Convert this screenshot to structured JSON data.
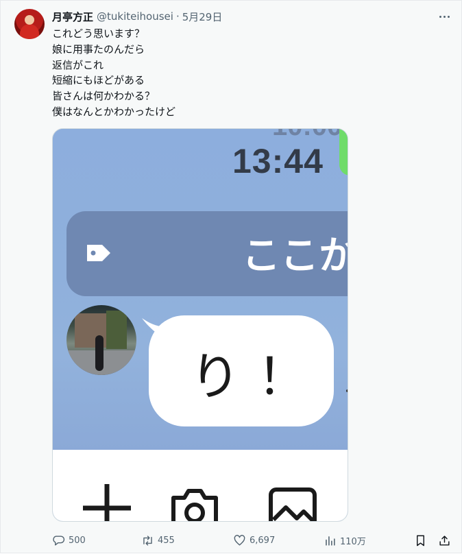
{
  "tweet": {
    "author_name": "月亭方正",
    "handle": "@tukiteihousei",
    "separator": "·",
    "date": "5月29日",
    "lines": [
      "これどう思います？",
      "娘に用事たのんだら",
      "返信がこれ",
      "短縮にもほどがある",
      "皆さんは何かわかる？",
      "僕はなんとかわかったけど"
    ]
  },
  "media": {
    "status_time_partial": "10:00",
    "time": "13:44",
    "banner_text": "ここか",
    "bubble_text": "り！",
    "icons": [
      "tag-icon",
      "plus-icon",
      "camera-icon",
      "image-icon"
    ]
  },
  "actions": {
    "replies": "500",
    "reposts": "455",
    "likes": "6,697",
    "views": "110万"
  },
  "colors": {
    "muted": "#536471",
    "chat_background": "#90aedc",
    "banner": "#6f88b2",
    "accent_green": "#6fdc6a"
  }
}
